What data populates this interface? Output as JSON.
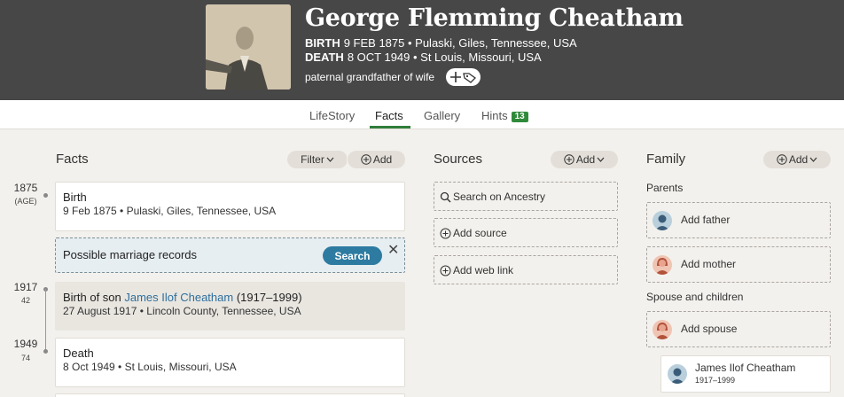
{
  "person": {
    "name": "George Flemming Cheatham",
    "birth_label": "BIRTH",
    "birth_value": "9 FEB 1875 • Pulaski, Giles, Tennessee, USA",
    "death_label": "DEATH",
    "death_value": "8 OCT 1949 • St Louis, Missouri, USA",
    "relation": "paternal grandfather of wife",
    "add_tag_icon": "plus-tag-icon"
  },
  "tabs": [
    {
      "label": "LifeStory",
      "active": false
    },
    {
      "label": "Facts",
      "active": true
    },
    {
      "label": "Gallery",
      "active": false
    },
    {
      "label": "Hints",
      "active": false,
      "badge": "13"
    }
  ],
  "facts": {
    "title": "Facts",
    "filter_label": "Filter",
    "add_label": "Add",
    "timeline": [
      {
        "year": "1875",
        "age": "(AGE)"
      },
      {
        "year": "1917",
        "age": "42"
      },
      {
        "year": "1949",
        "age": "74"
      }
    ],
    "birth": {
      "title": "Birth",
      "detail": "9 Feb 1875 • Pulaski, Giles, Tennessee, USA"
    },
    "suggestion": {
      "text": "Possible marriage records",
      "button": "Search"
    },
    "son": {
      "prefix": "Birth of son ",
      "name": "James Ilof Cheatham",
      "years": " (1917–1999)",
      "detail": "27 August 1917 • Lincoln County, Tennessee, USA"
    },
    "death": {
      "title": "Death",
      "detail": "8 Oct 1949 • St Louis, Missouri, USA"
    }
  },
  "sources": {
    "title": "Sources",
    "add_label": "Add",
    "items": [
      "Search on Ancestry",
      "Add source",
      "Add web link"
    ]
  },
  "family": {
    "title": "Family",
    "add_label": "Add",
    "parents_label": "Parents",
    "add_father": "Add father",
    "add_mother": "Add mother",
    "spouse_label": "Spouse and children",
    "add_spouse": "Add spouse",
    "child_name": "James Ilof Cheatham",
    "child_years": "1917–1999"
  },
  "colors": {
    "header_bg": "#474747",
    "active_tab_underline": "#2f7d3a",
    "link": "#2e6f9e",
    "search_button": "#2d7ba1",
    "badge": "#2f8a3a"
  }
}
